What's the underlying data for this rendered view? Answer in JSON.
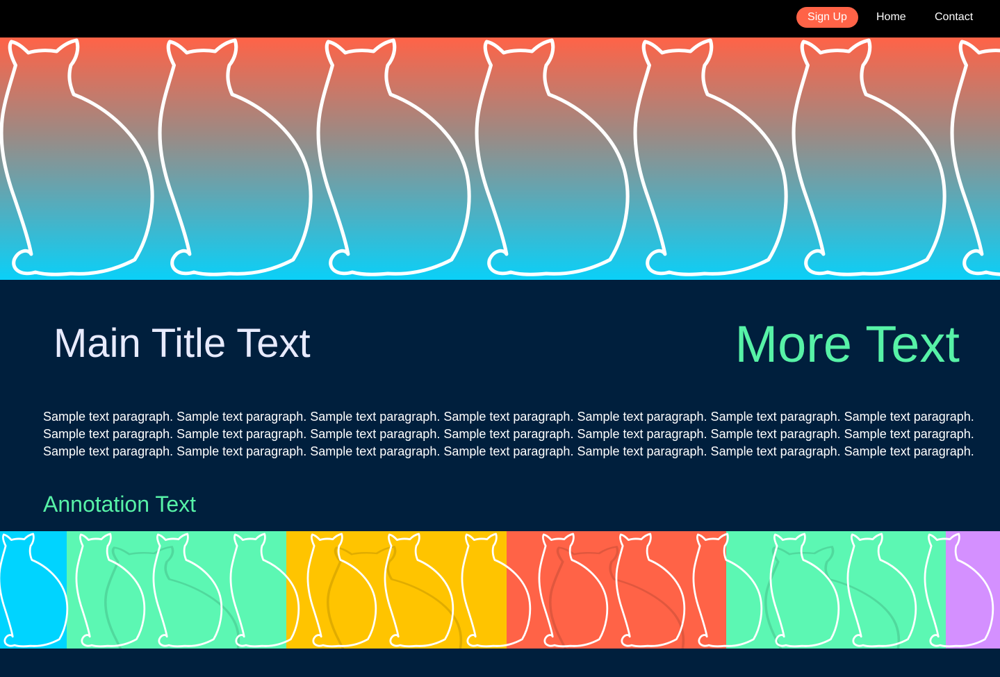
{
  "nav": {
    "signup_label": "Sign Up",
    "home_label": "Home",
    "contact_label": "Contact"
  },
  "colors": {
    "nav_background": "#000000",
    "signup_button": "#ff6347",
    "hero_gradient_top": "#ff6347",
    "hero_gradient_bottom": "#0ad0f8",
    "page_background": "#001f3d",
    "title_color": "#e8ebff",
    "accent_green": "#57f2a7",
    "strip_colors": [
      "#00d4ff",
      "#5cf7b3",
      "#ffc400",
      "#ff6347",
      "#5cf7b3",
      "#d490ff"
    ]
  },
  "hero": {
    "pattern_icon": "cat-silhouette-icon"
  },
  "main": {
    "title": "Main Title Text",
    "secondary_title": "More Text",
    "paragraph": "Sample text paragraph. Sample text paragraph. Sample text paragraph. Sample text paragraph. Sample text paragraph. Sample text paragraph. Sample text paragraph. Sample text paragraph. Sample text paragraph. Sample text paragraph. Sample text paragraph. Sample text paragraph. Sample text paragraph. Sample text paragraph. Sample text paragraph. Sample text paragraph. Sample text paragraph. Sample text paragraph. Sample text paragraph. Sample text paragraph. Sample text paragraph.",
    "annotation": "Annotation Text"
  },
  "strip": {
    "pattern_icon": "cat-silhouette-icon"
  }
}
